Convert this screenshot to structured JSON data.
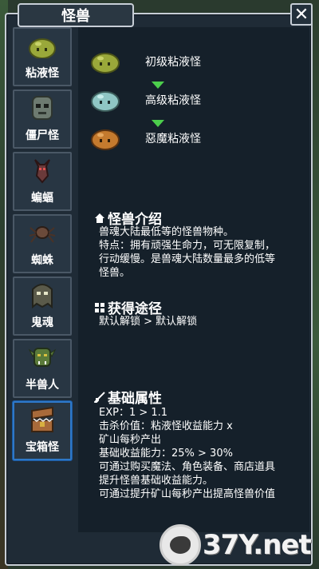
{
  "window": {
    "title": "怪兽",
    "close_label": "✕"
  },
  "sidebar": {
    "items": [
      {
        "label": "粘液怪",
        "icon": "green-slime-icon",
        "active": false
      },
      {
        "label": "僵尸怪",
        "icon": "zombie-icon",
        "active": false
      },
      {
        "label": "蝙蝠",
        "icon": "bat-icon",
        "active": false
      },
      {
        "label": "蜘蛛",
        "icon": "spider-icon",
        "active": false
      },
      {
        "label": "鬼魂",
        "icon": "ghost-icon",
        "active": false
      },
      {
        "label": "半兽人",
        "icon": "orc-icon",
        "active": false
      },
      {
        "label": "宝箱怪",
        "icon": "mimic-chest-icon",
        "active": true
      }
    ]
  },
  "evolution": {
    "stages": [
      {
        "name": "初级粘液怪",
        "color": "#9aa83a"
      },
      {
        "name": "高级粘液怪",
        "color": "#8fc6c4"
      },
      {
        "name": "惡魔粘液怪",
        "color": "#c47a2e"
      }
    ],
    "arrow_color": "#4cce4c"
  },
  "intro": {
    "title": "怪兽介绍",
    "lines": [
      "兽魂大陆最低等的怪兽物种。",
      "特点：拥有顽强生命力，可无限复制，",
      "行动缓慢。是兽魂大陆数量最多的低等",
      "怪兽。"
    ]
  },
  "obtain": {
    "title": "获得途径",
    "lines": [
      "默认解锁 > 默认解锁"
    ]
  },
  "attributes": {
    "title": "基础属性",
    "lines": [
      "EXP：1 > 1.1",
      "击杀价值：粘液怪收益能力 x",
      "矿山每秒产出",
      "基础收益能力：25% > 30%",
      "可通过购买魔法、角色装备、商店道具",
      "提升怪兽基础收益能力。",
      "可通过提升矿山每秒产出提高怪兽价值"
    ]
  },
  "watermark": {
    "text": "37Y.net"
  }
}
